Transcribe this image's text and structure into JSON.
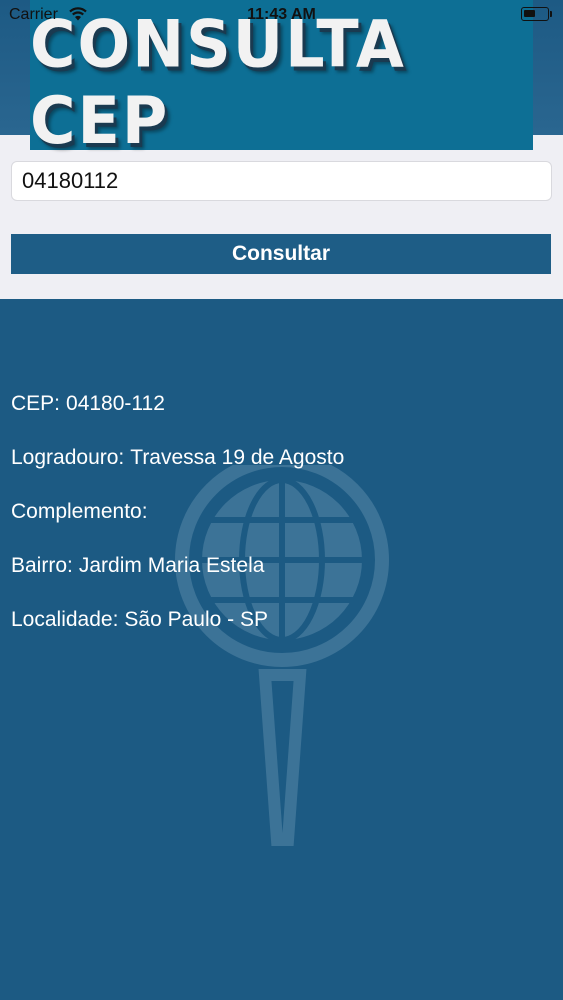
{
  "status_bar": {
    "carrier": "Carrier",
    "time": "11:43 AM",
    "wifi_icon": "wifi-icon",
    "battery_icon": "battery-icon"
  },
  "banner": {
    "title": "CONSULTA CEP"
  },
  "form": {
    "cep_value": "04180112",
    "cep_placeholder": "",
    "button_label": "Consultar"
  },
  "results": [
    {
      "label": "CEP:",
      "value": "04180-112"
    },
    {
      "label": "Logradouro:",
      "value": "Travessa 19 de Agosto"
    },
    {
      "label": "Complemento:",
      "value": ""
    },
    {
      "label": "Bairro:",
      "value": "Jardim Maria Estela"
    },
    {
      "label": "Localidade:",
      "value": "São Paulo - SP"
    }
  ],
  "colors": {
    "background": "#1c5a83",
    "banner": "#0d6f95",
    "button": "#1e5d86",
    "form_background": "#efeff4"
  },
  "watermark_icon": "globe-pin-icon"
}
